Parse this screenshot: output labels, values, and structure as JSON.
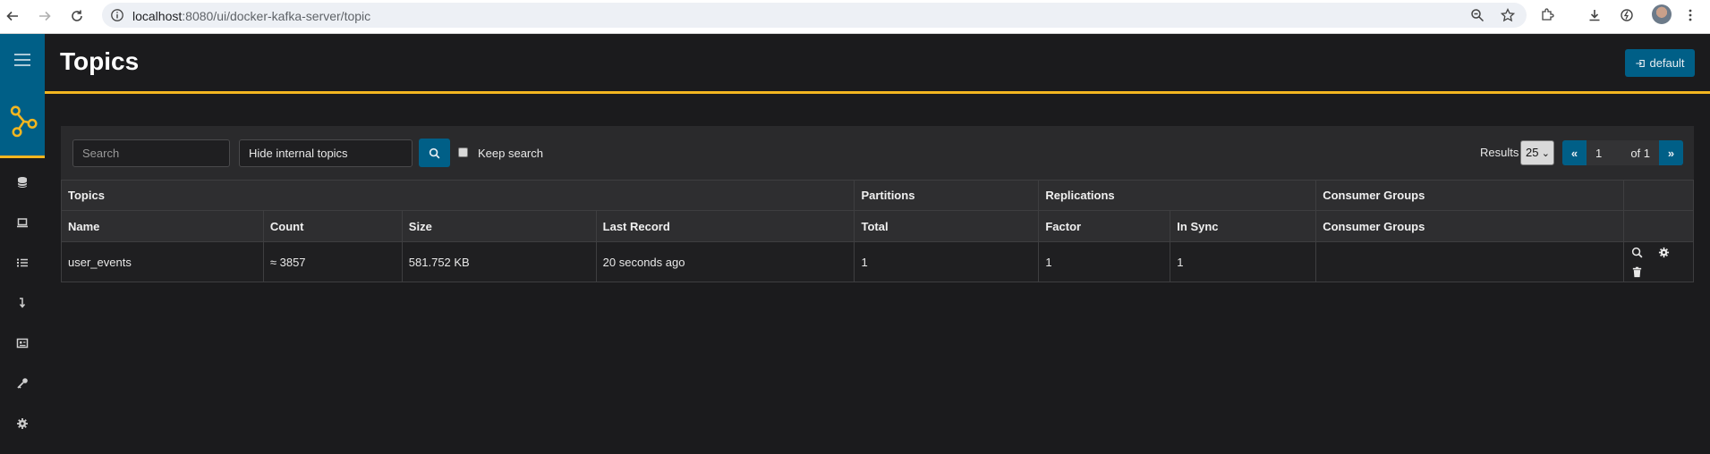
{
  "browser": {
    "url_host": "localhost",
    "url_rest": ":8080/ui/docker-kafka-server/topic"
  },
  "sidebar": {
    "items": [
      {
        "icon": "database-icon"
      },
      {
        "icon": "laptop-icon"
      },
      {
        "icon": "list-icon"
      },
      {
        "icon": "arrow-down-icon"
      },
      {
        "icon": "schema-icon"
      },
      {
        "icon": "key-icon"
      },
      {
        "icon": "gear-icon"
      }
    ]
  },
  "header": {
    "title": "Topics",
    "cluster_button": "default"
  },
  "toolbar": {
    "search_placeholder": "Search",
    "internal_topics": "Hide internal topics",
    "keep_search_label": "Keep search",
    "results_label": "Results",
    "results_per_page": "25",
    "page_prev": "«",
    "page_current": "1",
    "page_of": "of 1",
    "page_next": "»"
  },
  "table": {
    "group_headers": [
      "Topics",
      "Partitions",
      "Replications",
      "Consumer Groups"
    ],
    "column_headers": [
      "Name",
      "Count",
      "Size",
      "Last Record",
      "Total",
      "Factor",
      "In Sync",
      "Consumer Groups"
    ],
    "rows": [
      {
        "name": "user_events",
        "count": "≈ 3857",
        "size": "581.752 KB",
        "last_record": "20 seconds ago",
        "partitions_total": "1",
        "replication_factor": "1",
        "in_sync": "1",
        "consumer_groups": ""
      }
    ]
  },
  "colors": {
    "accent": "#005f87",
    "highlight": "#f3b620",
    "background": "#1b1b1d"
  }
}
